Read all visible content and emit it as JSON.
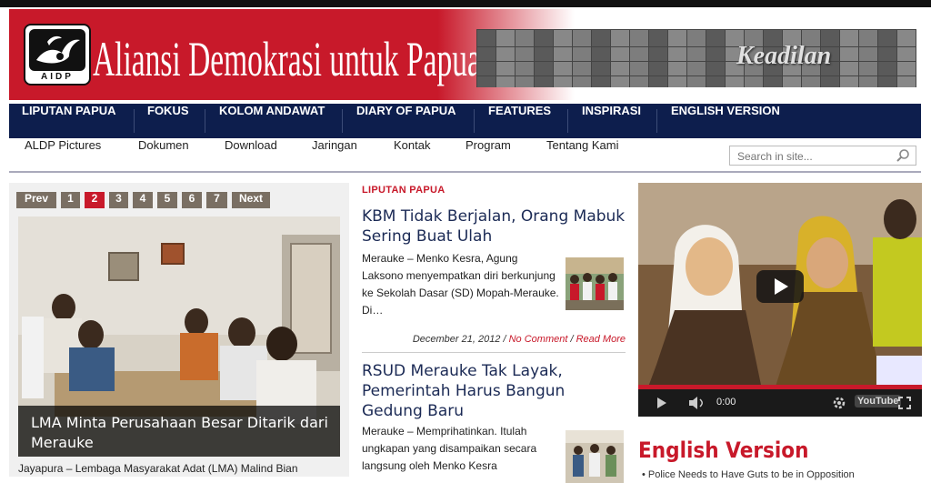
{
  "header": {
    "logo_sub": "AIDP",
    "site_title": "Aliansi Demokrasi untuk Papua",
    "banner_text": "Keadilan"
  },
  "main_nav": [
    "LIPUTAN PAPUA",
    "FOKUS",
    "KOLOM ANDAWAT",
    "DIARY OF PAPUA",
    "FEATURES",
    "INSPIRASI",
    "ENGLISH VERSION"
  ],
  "sub_nav": [
    "ALDP Pictures",
    "Dokumen",
    "Download",
    "Jaringan",
    "Kontak",
    "Program",
    "Tentang Kami"
  ],
  "search": {
    "placeholder": "Search in site..."
  },
  "slider": {
    "prev": "Prev",
    "pages": [
      "1",
      "2",
      "3",
      "4",
      "5",
      "6",
      "7"
    ],
    "active_page": "2",
    "next": "Next",
    "caption": "LMA Minta Perusahaan Besar Ditarik dari Merauke",
    "excerpt": "Jayapura – Lembaga Masyarakat Adat (LMA) Malind Bian"
  },
  "middle": {
    "category": "LIPUTAN PAPUA",
    "articles": [
      {
        "title": "KBM Tidak Berjalan, Orang Mabuk Sering Buat Ulah",
        "excerpt": "Merauke – Menko Kesra, Agung Laksono menyempatkan diri berkunjung ke Sekolah Dasar (SD) Mopah-Merauke. Di…",
        "date": "December 21, 2012",
        "sep1": " / ",
        "comment": "No Comment",
        "sep2": " / ",
        "read_more": "Read More"
      },
      {
        "title": "RSUD Merauke Tak Layak, Pemerintah Harus Bangun Gedung Baru",
        "excerpt": "Merauke – Memprihatinkan. Itulah ungkapan yang disampaikan secara langsung oleh Menko Kesra"
      }
    ]
  },
  "video": {
    "time": "0:00",
    "brand": "YouTube"
  },
  "english": {
    "title": "English Version",
    "item": "• Police Needs to Have Guts to be in Opposition"
  },
  "colors": {
    "brand_red": "#c8192a",
    "nav_navy": "#0d1e4d"
  }
}
